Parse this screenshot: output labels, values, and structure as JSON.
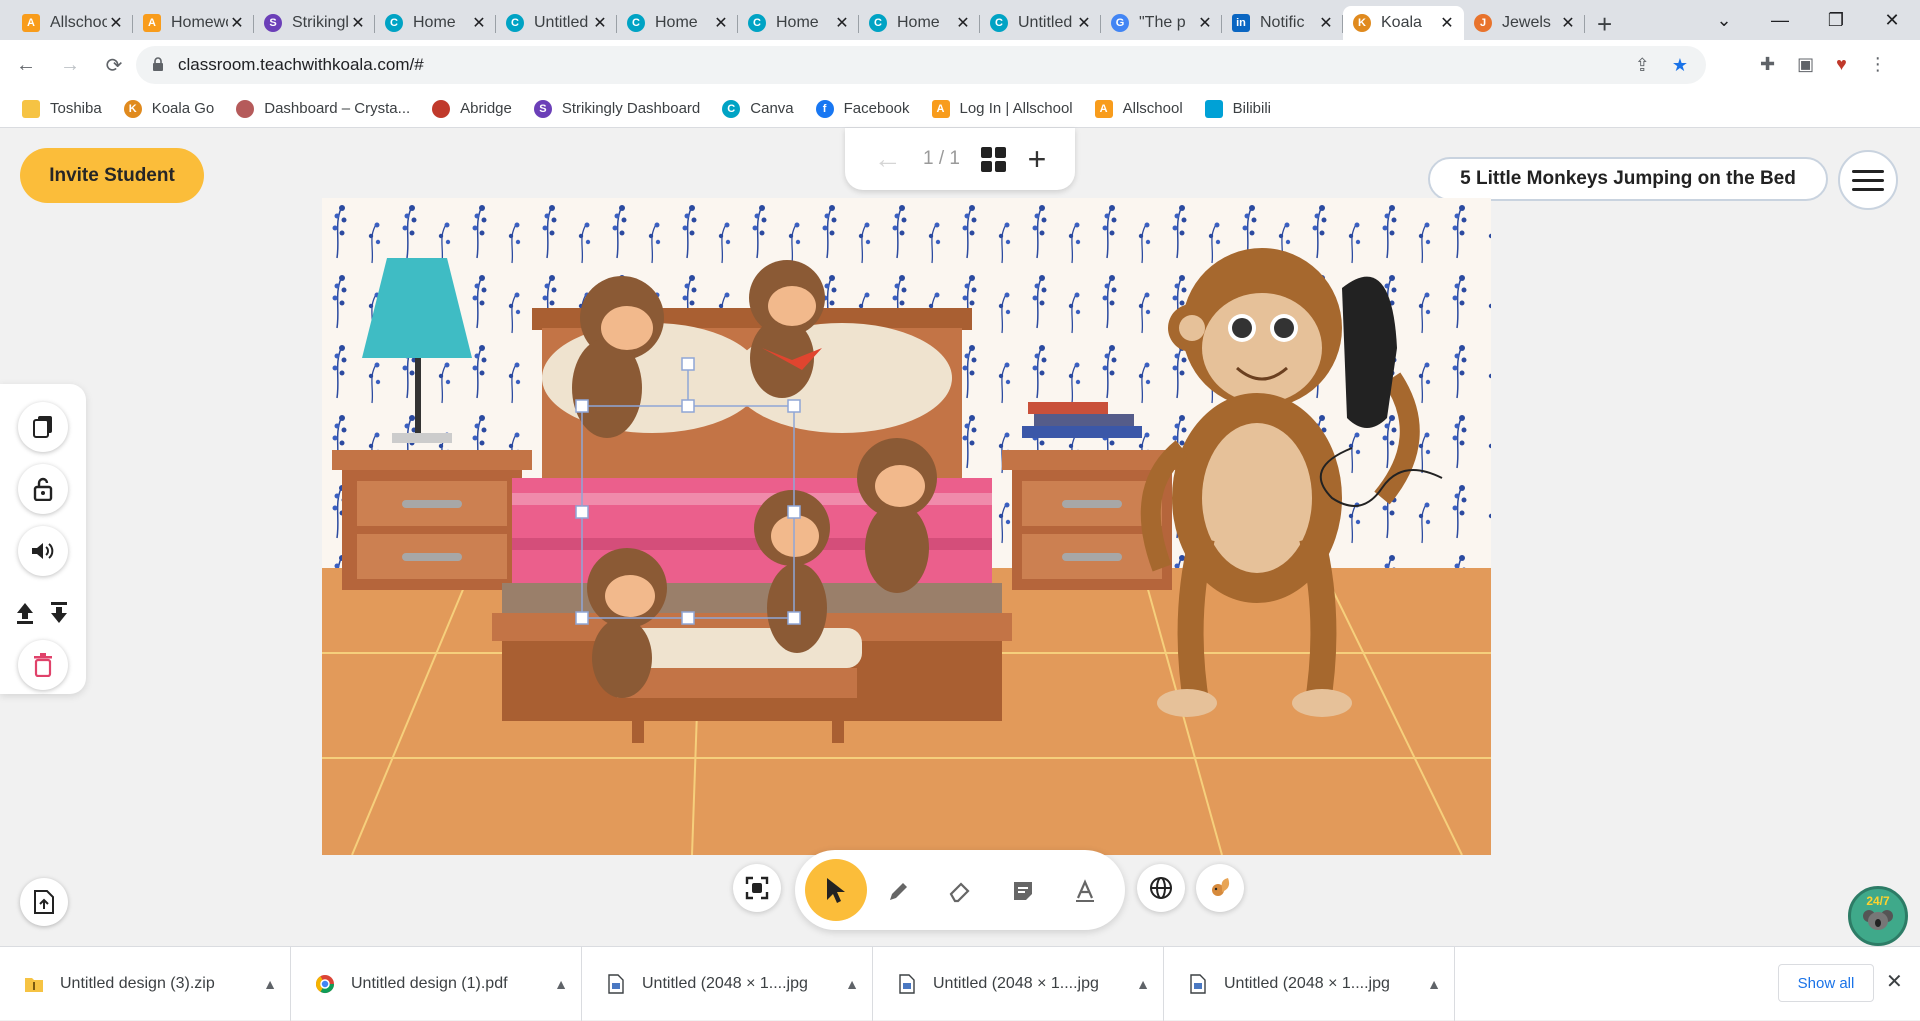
{
  "browser": {
    "tabs": [
      {
        "title": "Allschool",
        "favicon": "A",
        "color": "#f89c1c",
        "shape": "sq"
      },
      {
        "title": "Homework",
        "favicon": "A",
        "color": "#f89c1c",
        "shape": "sq"
      },
      {
        "title": "Strikingly",
        "favicon": "S",
        "color": "#6b3fb8",
        "shape": "round"
      },
      {
        "title": "Home",
        "favicon": "C",
        "color": "#00a3c4",
        "shape": "round"
      },
      {
        "title": "Untitled",
        "favicon": "C",
        "color": "#00a3c4",
        "shape": "round"
      },
      {
        "title": "Home",
        "favicon": "C",
        "color": "#00a3c4",
        "shape": "round"
      },
      {
        "title": "Home",
        "favicon": "C",
        "color": "#00a3c4",
        "shape": "round"
      },
      {
        "title": "Home",
        "favicon": "C",
        "color": "#00a3c4",
        "shape": "round"
      },
      {
        "title": "Untitled",
        "favicon": "C",
        "color": "#00a3c4",
        "shape": "round"
      },
      {
        "title": "\"The p",
        "favicon": "G",
        "color": "#4285f4",
        "shape": "round"
      },
      {
        "title": "Notific",
        "favicon": "in",
        "color": "#0a66c2",
        "shape": "sq"
      },
      {
        "title": "Koala",
        "favicon": "K",
        "color": "#e08a1e",
        "shape": "round"
      },
      {
        "title": "Jewels",
        "favicon": "J",
        "color": "#e8732c",
        "shape": "round"
      }
    ],
    "active_tab_index": 11,
    "new_tab_icon": "plus-icon",
    "url": "classroom.teachwithkoala.com/#",
    "bookmarks": [
      {
        "label": "Toshiba",
        "favicon": "",
        "color": "#f6c343",
        "shape": "sq"
      },
      {
        "label": "Koala Go",
        "favicon": "K",
        "color": "#e08a1e",
        "shape": "round"
      },
      {
        "label": "Dashboard – Crysta...",
        "favicon": "",
        "color": "#b55a5a",
        "shape": "round"
      },
      {
        "label": "Abridge",
        "favicon": "",
        "color": "#c0392b",
        "shape": "round"
      },
      {
        "label": "Strikingly Dashboard",
        "favicon": "S",
        "color": "#6b3fb8",
        "shape": "round"
      },
      {
        "label": "Canva",
        "favicon": "C",
        "color": "#00a3c4",
        "shape": "round"
      },
      {
        "label": "Facebook",
        "favicon": "f",
        "color": "#1877f2",
        "shape": "round"
      },
      {
        "label": "Log In | Allschool",
        "favicon": "A",
        "color": "#f89c1c",
        "shape": "sq"
      },
      {
        "label": "Allschool",
        "favicon": "A",
        "color": "#f89c1c",
        "shape": "sq"
      },
      {
        "label": "Bilibili",
        "favicon": "",
        "color": "#00a1d6",
        "shape": "sq"
      }
    ]
  },
  "app": {
    "invite_label": "Invite Student",
    "page_count": "1 / 1",
    "lesson_title": "5 Little Monkeys Jumping on the Bed",
    "accent": "#fbbd3a",
    "left_tools": [
      "copy-icon",
      "unlock-icon",
      "speaker-icon",
      "bring-forward-icon",
      "send-backward-icon",
      "delete-icon"
    ],
    "bottom_tools": [
      "fit-screen-icon",
      "select-cursor-icon",
      "pen-icon",
      "eraser-icon",
      "sticky-note-icon",
      "text-icon",
      "globe-icon",
      "squirrel-sticker-icon"
    ],
    "support_badge": "24/7"
  },
  "downloads": {
    "items": [
      {
        "name": "Untitled design (3).zip",
        "icon": "zip-icon"
      },
      {
        "name": "Untitled design (1).pdf",
        "icon": "chrome-pdf-icon"
      },
      {
        "name": "Untitled (2048 × 1....jpg",
        "icon": "image-file-icon"
      },
      {
        "name": "Untitled (2048 × 1....jpg",
        "icon": "image-file-icon"
      },
      {
        "name": "Untitled (2048 × 1....jpg",
        "icon": "image-file-icon"
      }
    ],
    "show_all_label": "Show all"
  }
}
